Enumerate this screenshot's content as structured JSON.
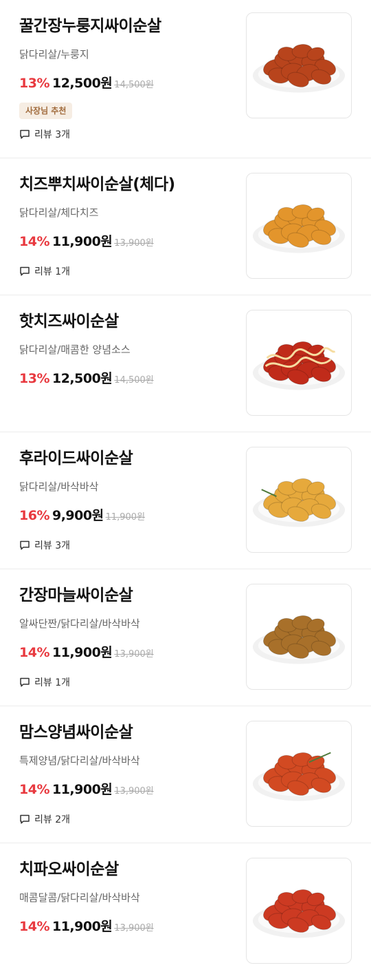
{
  "menu_items": [
    {
      "name": "꿀간장누룽지싸이순살",
      "description": "닭다리살/누룽지",
      "discount": "13%",
      "price": "12,500원",
      "original_price": "14,500원",
      "badge": "사장님 추천",
      "review": "리뷰 3개",
      "image_icon": "honey-soy-chicken",
      "food_color": "#b8441c"
    },
    {
      "name": "치즈뿌치싸이순살(체다)",
      "description": "닭다리살/체다치즈",
      "discount": "14%",
      "price": "11,900원",
      "original_price": "13,900원",
      "review": "리뷰 1개",
      "image_icon": "cheddar-cheese-chicken",
      "food_color": "#e3952c"
    },
    {
      "name": "핫치즈싸이순살",
      "description": "닭다리살/매콤한 양념소스",
      "discount": "13%",
      "price": "12,500원",
      "original_price": "14,500원",
      "image_icon": "hot-cheese-chicken",
      "food_color": "#c02b1a"
    },
    {
      "name": "후라이드싸이순살",
      "description": "닭다리살/바삭바삭",
      "discount": "16%",
      "price": "9,900원",
      "original_price": "11,900원",
      "review": "리뷰 3개",
      "image_icon": "fried-chicken",
      "food_color": "#e6a93c"
    },
    {
      "name": "간장마늘싸이순살",
      "description": "알싸단짠/닭다리살/바삭바삭",
      "discount": "14%",
      "price": "11,900원",
      "original_price": "13,900원",
      "review": "리뷰 1개",
      "image_icon": "soy-garlic-chicken",
      "food_color": "#a8702a"
    },
    {
      "name": "맘스양념싸이순살",
      "description": "특제양념/닭다리살/바삭바삭",
      "discount": "14%",
      "price": "11,900원",
      "original_price": "13,900원",
      "review": "리뷰 2개",
      "image_icon": "seasoned-chicken",
      "food_color": "#d24a22"
    },
    {
      "name": "치파오싸이순살",
      "description": "매콤달콤/닭다리살/바삭바삭",
      "discount": "14%",
      "price": "11,900원",
      "original_price": "13,900원",
      "image_icon": "chipao-chicken",
      "food_color": "#cc3a22"
    }
  ],
  "colors": {
    "discount": "#e8393f",
    "badge_bg": "#f6ede3",
    "badge_text": "#a06a3b"
  }
}
